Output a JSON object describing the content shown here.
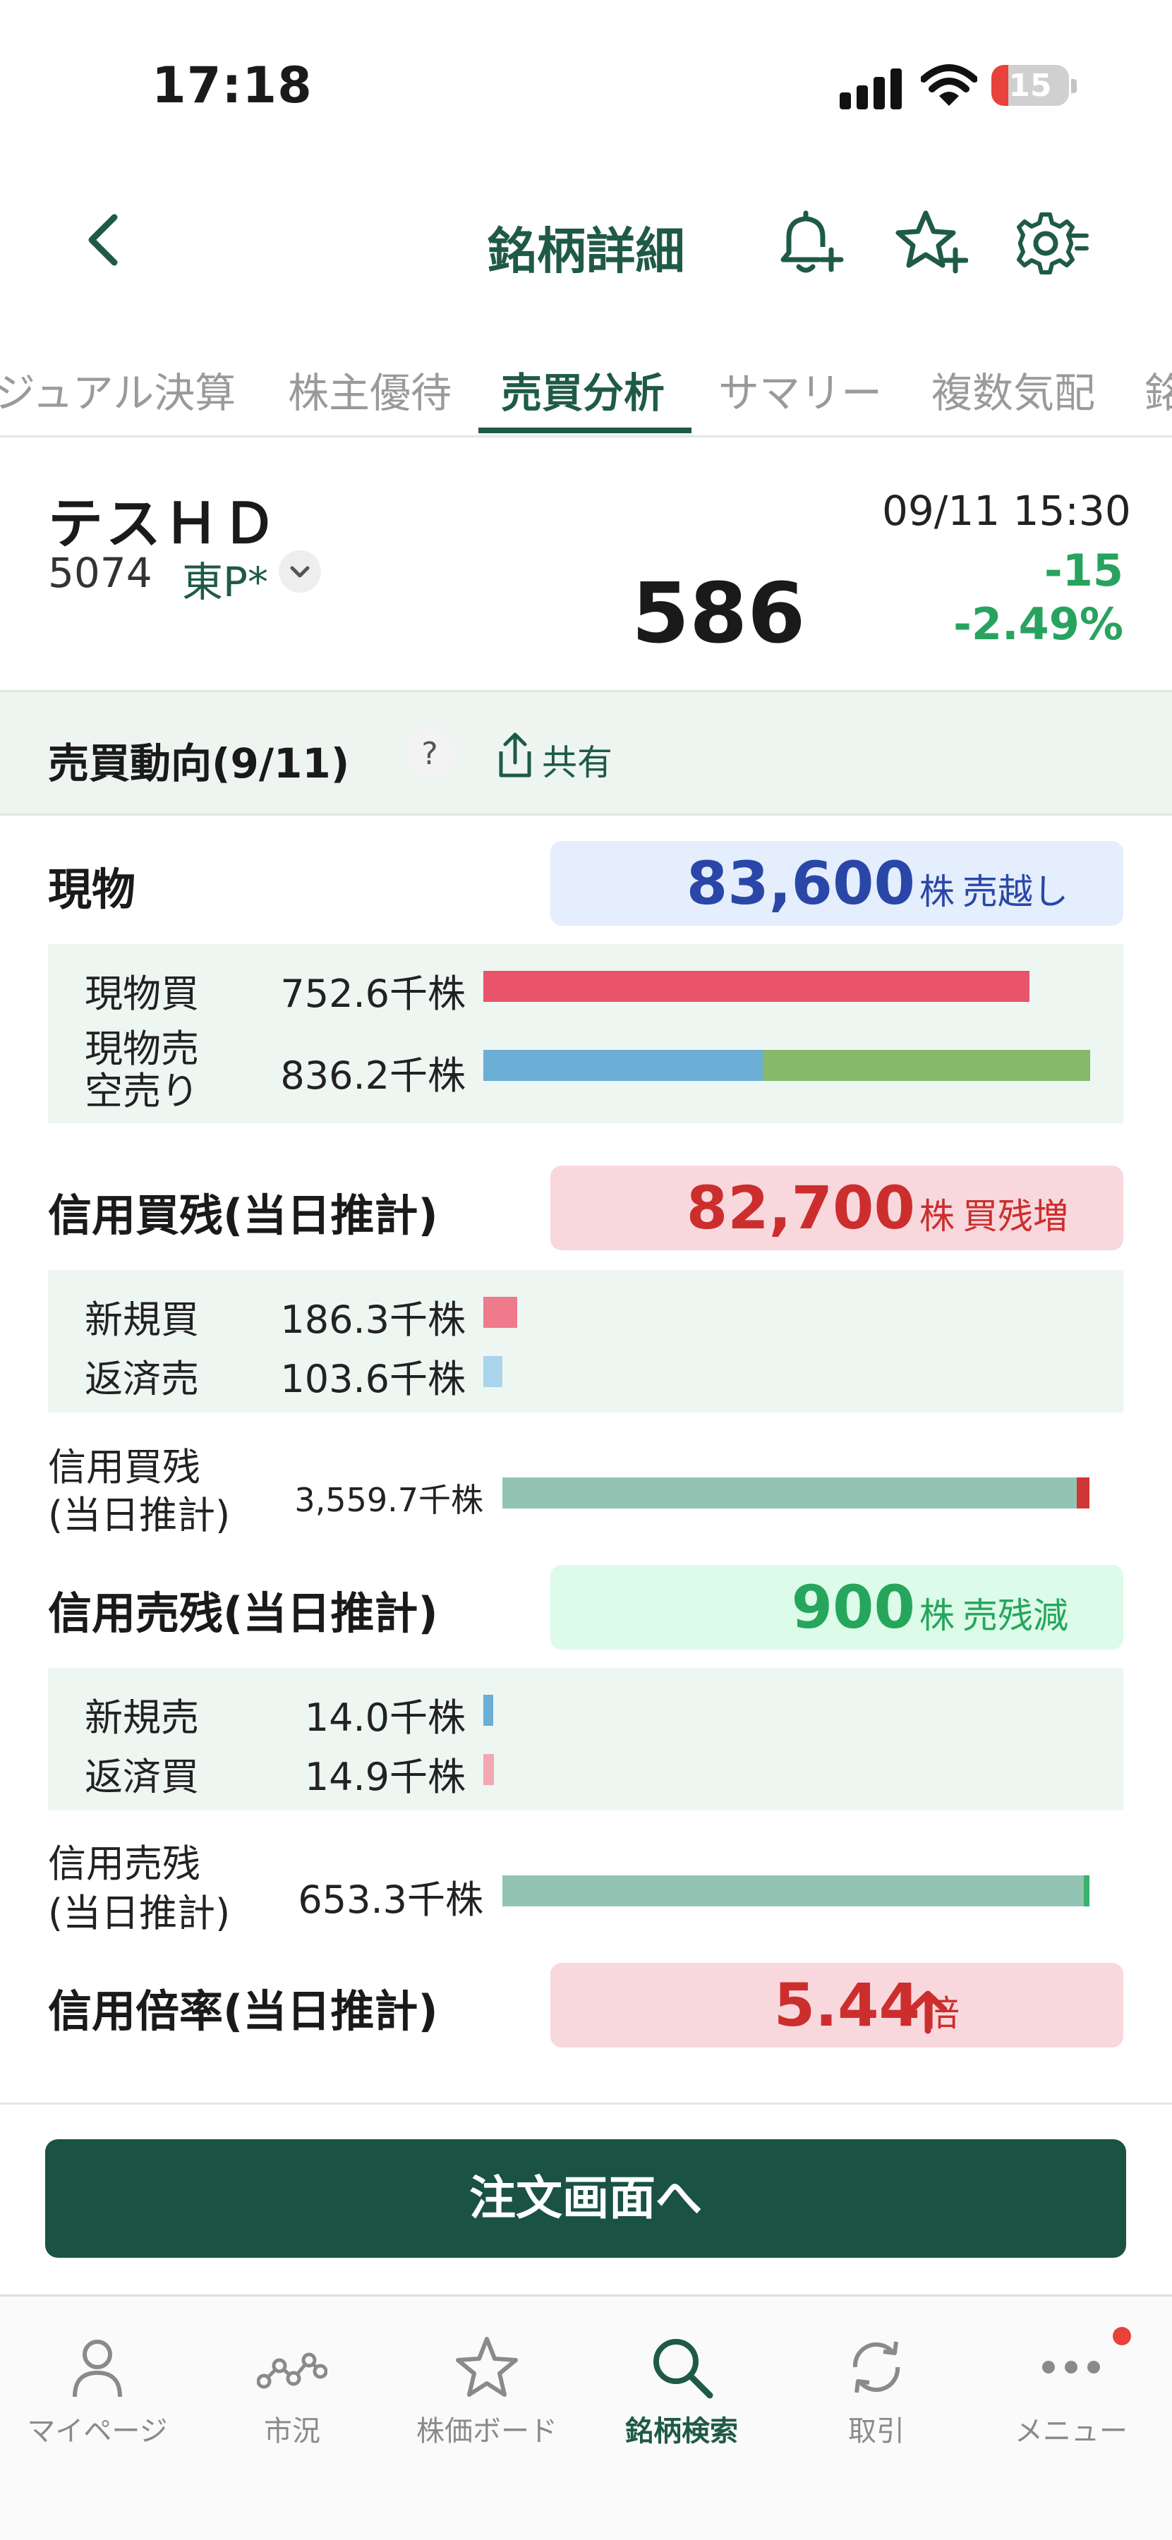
{
  "status_bar": {
    "time": "17:18",
    "battery": "15"
  },
  "header": {
    "title": "銘柄詳細"
  },
  "tabs": [
    {
      "label": "ジュアル決算"
    },
    {
      "label": "株主優待"
    },
    {
      "label": "売買分析",
      "active": true
    },
    {
      "label": "サマリー"
    },
    {
      "label": "複数気配"
    },
    {
      "label": "銘"
    }
  ],
  "stock": {
    "name": "テスＨＤ",
    "code": "5074",
    "market": "東P*",
    "price": "586",
    "datetime": "09/11 15:30",
    "change": "-15",
    "change_pct": "-2.49%"
  },
  "section": {
    "title": "売買動向(9/11)",
    "help": "?",
    "share_label": "共有"
  },
  "spot": {
    "label": "現物",
    "value": "83,600",
    "unit": "株",
    "status": "売越し",
    "rows": [
      {
        "label": "現物買",
        "value": "752.6千株",
        "shares_k": 752.6,
        "color": "#e9546b"
      },
      {
        "label": "現物売",
        "label2": "空売り",
        "value": "836.2千株",
        "shares_k": 836.2,
        "parts": [
          {
            "color": "#6baed6",
            "fraction": 0.46
          },
          {
            "color": "#86b96a",
            "fraction": 0.54
          }
        ]
      }
    ]
  },
  "margin_buy": {
    "label": "信用買残(当日推計)",
    "value": "82,700",
    "unit": "株",
    "status": "買残増",
    "rows": [
      {
        "label": "新規買",
        "value": "186.3千株",
        "shares_k": 186.3,
        "color": "#ee7a8c"
      },
      {
        "label": "返済売",
        "value": "103.6千株",
        "shares_k": 103.6,
        "color": "#a9d4ec"
      }
    ],
    "total": {
      "label1": "信用買残",
      "label2": "(当日推計)",
      "value": "3,559.7千株",
      "shares_k": 3559.7,
      "color": "#93c4b3",
      "delta_color": "#d13636"
    }
  },
  "margin_sell": {
    "label": "信用売残(当日推計)",
    "value": "900",
    "unit": "株",
    "status": "売残減",
    "rows": [
      {
        "label": "新規売",
        "value": "14.0千株",
        "shares_k": 14.0,
        "color": "#6baed6"
      },
      {
        "label": "返済買",
        "value": "14.9千株",
        "shares_k": 14.9,
        "color": "#f2a7b2"
      }
    ],
    "total": {
      "label1": "信用売残",
      "label2": "(当日推計)",
      "value": "653.3千株",
      "shares_k": 653.3,
      "color": "#93c4b3",
      "delta_color": "#3bb26c"
    }
  },
  "margin_ratio": {
    "label": "信用倍率(当日推計)",
    "value": "5.44",
    "unit": "倍",
    "trend": "up"
  },
  "order_button": "注文画面へ",
  "bottom_nav": [
    {
      "label": "マイページ",
      "icon": "person-icon"
    },
    {
      "label": "市況",
      "icon": "market-icon"
    },
    {
      "label": "株価ボード",
      "icon": "star-icon"
    },
    {
      "label": "銘柄検索",
      "icon": "search-icon",
      "active": true
    },
    {
      "label": "取引",
      "icon": "refresh-icon"
    },
    {
      "label": "メニュー",
      "icon": "more-icon"
    }
  ],
  "colors": {
    "brand": "#1f5a48",
    "up": "#d13636",
    "down": "#27a35f",
    "sell_box": "#e4eefc",
    "buy_box": "#f8d8dc",
    "short_box": "#dcfbe8"
  }
}
